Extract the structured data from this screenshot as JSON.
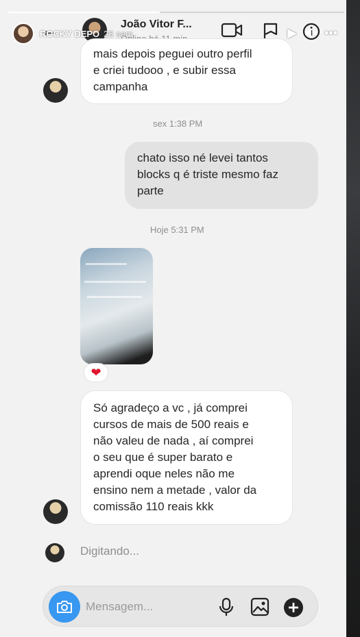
{
  "story": {
    "username": "ROCKY DEPO",
    "time_ago": "26 sem",
    "progress": 0.45
  },
  "chat": {
    "contact_name": "João Vitor F...",
    "status": "Online há 11 min"
  },
  "messages": {
    "first_incoming": [
      "mais depois peguei outro perfil",
      "e criei tudooo , e subir essa",
      "campanha"
    ],
    "timestamp_1": "sex 1:38 PM",
    "outgoing": [
      "chato isso né levei tantos",
      "blocks q é triste mesmo faz",
      "parte"
    ],
    "timestamp_2": "Hoje 5:31 PM",
    "reaction": "❤",
    "second_incoming": [
      "Só agradeço a vc  , já comprei",
      "cursos  de mais de 500 reais e",
      "não valeu de nada , aí comprei",
      "o seu que é super barato e",
      "aprendi oque neles não me",
      "ensino nem a metade , valor da",
      "comissão 110 reais kkk"
    ],
    "typing": "Digitando..."
  },
  "composer": {
    "placeholder": "Mensagem..."
  },
  "colors": {
    "accent": "#3897f0",
    "heart": "#e0152b"
  }
}
